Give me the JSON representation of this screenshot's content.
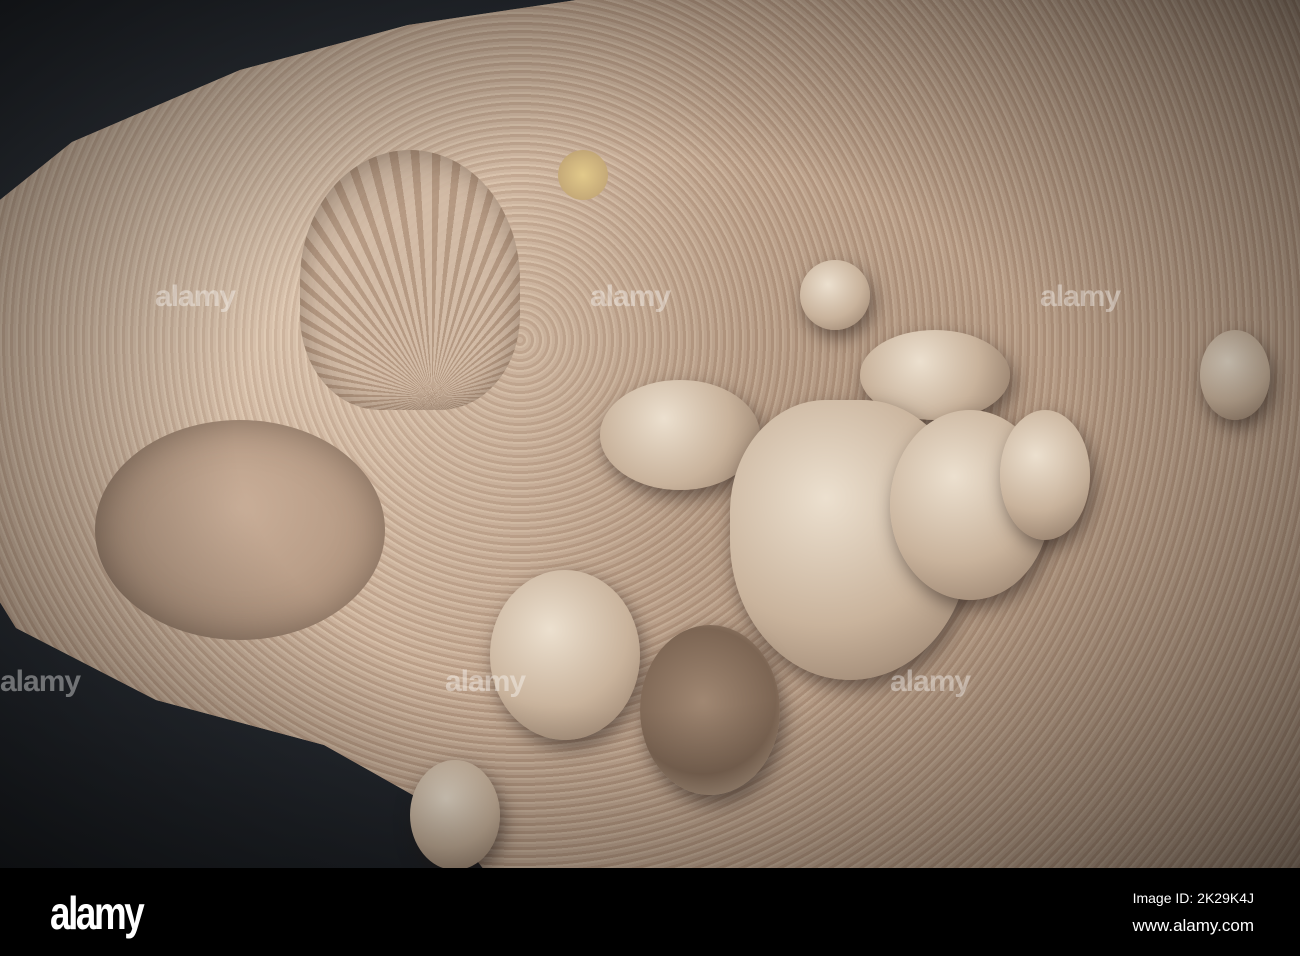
{
  "watermark": {
    "text": "alamy"
  },
  "footer": {
    "logo": "alamy",
    "image_id": "Image ID: 2K29K4J",
    "url": "www.alamy.com"
  }
}
